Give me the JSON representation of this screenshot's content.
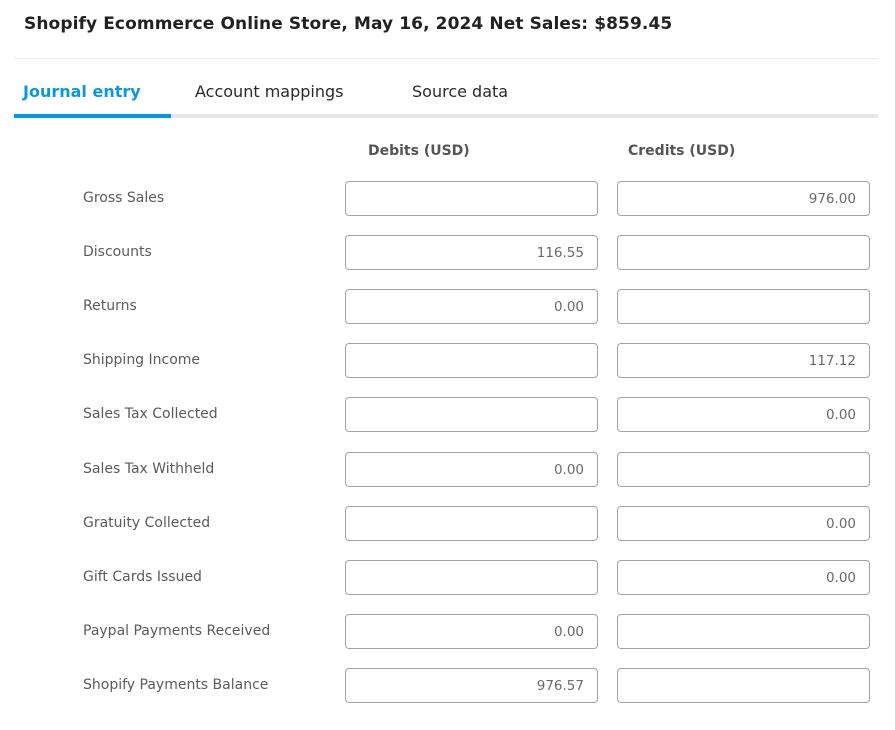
{
  "header": {
    "title": "Shopify Ecommerce Online Store, May 16, 2024 Net Sales: $859.45"
  },
  "tabs": [
    {
      "label": "Journal entry",
      "active": true
    },
    {
      "label": "Account mappings",
      "active": false
    },
    {
      "label": "Source data",
      "active": false
    }
  ],
  "colors": {
    "accent": "#0099DD",
    "tab_track": "#E6E7EA",
    "input_border": "#9EA3AD"
  },
  "table": {
    "debits_header": "Debits (USD)",
    "credits_header": "Credits (USD)",
    "rows": [
      {
        "label": "Gross Sales",
        "debit": "",
        "credit": "976.00"
      },
      {
        "label": "Discounts",
        "debit": "116.55",
        "credit": ""
      },
      {
        "label": "Returns",
        "debit": "0.00",
        "credit": ""
      },
      {
        "label": "Shipping Income",
        "debit": "",
        "credit": "117.12"
      },
      {
        "label": "Sales Tax Collected",
        "debit": "",
        "credit": "0.00"
      },
      {
        "label": "Sales Tax Withheld",
        "debit": "0.00",
        "credit": ""
      },
      {
        "label": "Gratuity Collected",
        "debit": "",
        "credit": "0.00"
      },
      {
        "label": "Gift Cards Issued",
        "debit": "",
        "credit": "0.00"
      },
      {
        "label": "Paypal Payments Received",
        "debit": "0.00",
        "credit": ""
      },
      {
        "label": "Shopify Payments Balance",
        "debit": "976.57",
        "credit": ""
      }
    ]
  }
}
